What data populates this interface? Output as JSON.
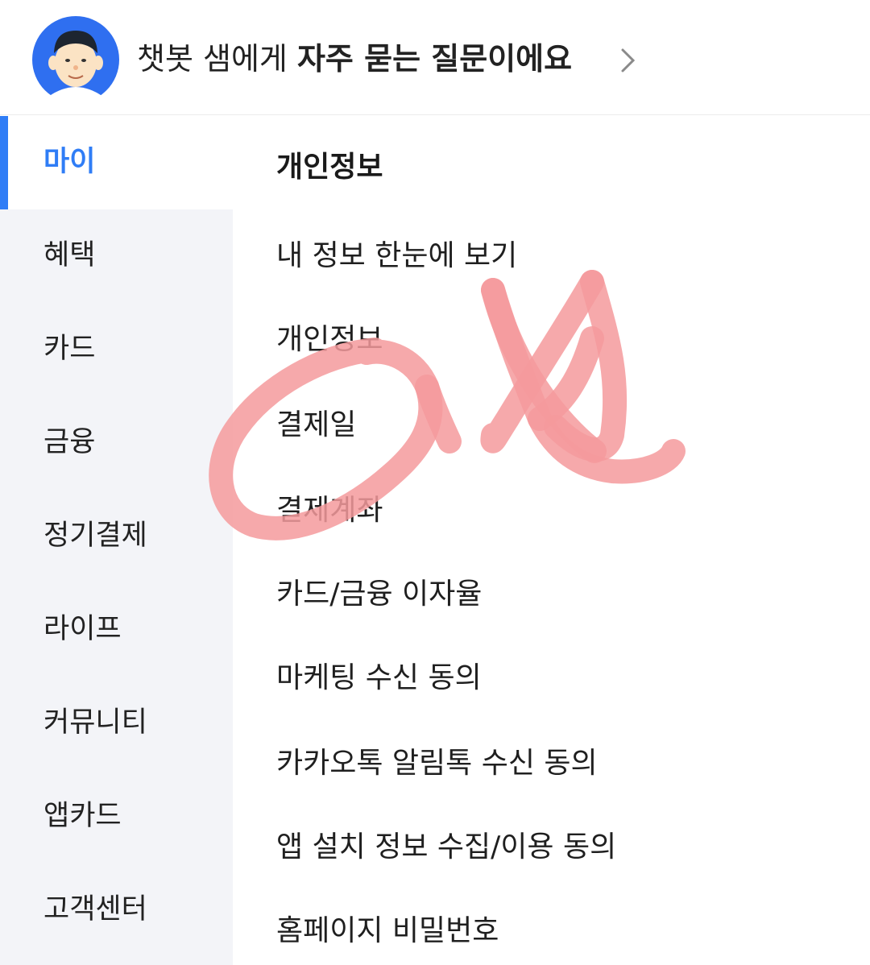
{
  "header": {
    "text_prefix": "챗봇 샘에게 ",
    "text_bold": "자주 묻는 질문이에요",
    "avatar_icon": "chatbot-avatar-icon",
    "chevron_icon": "chevron-right-icon"
  },
  "sidebar": {
    "items": [
      {
        "label": "마이",
        "active": true
      },
      {
        "label": "혜택"
      },
      {
        "label": "카드"
      },
      {
        "label": "금융"
      },
      {
        "label": "정기결제"
      },
      {
        "label": "라이프"
      },
      {
        "label": "커뮤니티"
      },
      {
        "label": "앱카드"
      },
      {
        "label": "고객센터"
      }
    ]
  },
  "content": {
    "section_title": "개인정보",
    "items": [
      "내 정보 한눈에 보기",
      "개인정보",
      "결제일",
      "결제계좌",
      "카드/금융 이자율",
      "마케팅 수신 동의",
      "카카오톡 알림톡 수신 동의",
      "앱 설치 정보 수집/이용 동의",
      "홈페이지 비밀번호"
    ]
  },
  "colors": {
    "accent": "#2f7df6",
    "sidebar_bg": "#f3f4f8",
    "scribble": "#f59a9c"
  }
}
